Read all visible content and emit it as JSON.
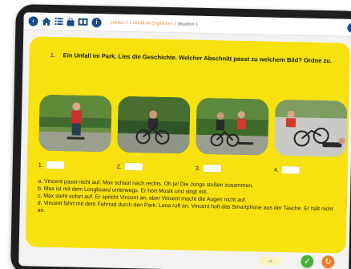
{
  "breadcrumb": {
    "path": "Lektion 7 1 Unfall im Englischen",
    "separator": "|",
    "current": "Situation 1"
  },
  "topbar": {
    "icons": [
      "back-icon",
      "home-icon",
      "list-icon",
      "bag-icon",
      "book-icon",
      "info-icon"
    ],
    "info_glyph": "i"
  },
  "task": {
    "number": "1.",
    "text": "Ein Unfall im Park. Lies die Geschichte. Welcher Abschnitt passt zu welchem Bild? Ordne zu."
  },
  "slots": [
    {
      "label": "1."
    },
    {
      "label": "2."
    },
    {
      "label": "3."
    },
    {
      "label": "4."
    }
  ],
  "answers": [
    "a. Vincent passt nicht auf. Max schaut nach rechts. Oh je! Die Jungs stoßen zusammen.",
    "b. Max ist mit dem Longboard unterwegs. Er hört Musik und singt mit.",
    "c. Max steht sofort auf. Er spricht Vincent an, aber Vincent macht die Augen nicht auf.",
    "d. Vincent fährt mit dem Fahrrad durch den Park. Lena ruft an. Vincent holt das Smartphone aus der Tasche. Er hält nicht an."
  ],
  "footer": {
    "neutral_label": "ok"
  },
  "colors": {
    "card": "#f7e10f",
    "nav": "#174a8a",
    "check": "#4caf3c",
    "reset": "#ef7d2a"
  }
}
